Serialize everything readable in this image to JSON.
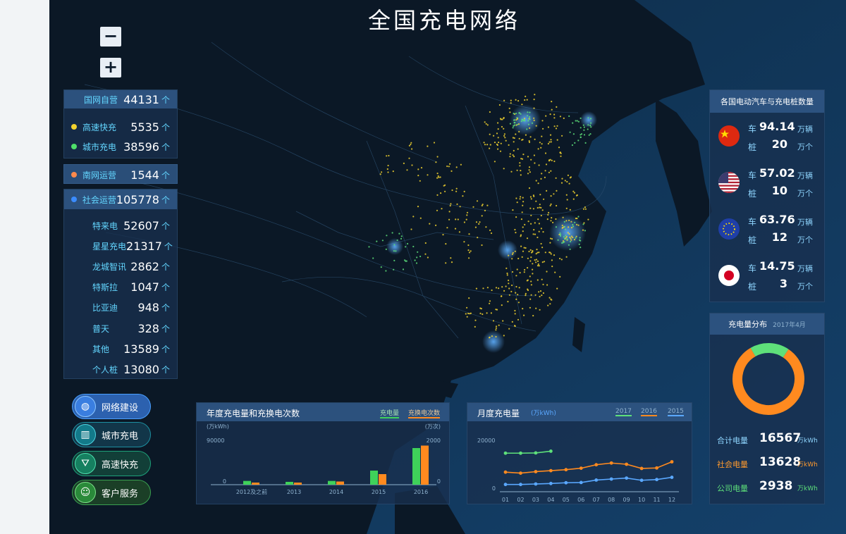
{
  "title": "全国充电网络",
  "zoom": {
    "minus": "−",
    "plus": "+"
  },
  "left_stats": {
    "grid_own": {
      "label": "国网自营",
      "value": "44131",
      "unit": "个"
    },
    "highway": {
      "label": "高速快充",
      "value": "5535",
      "unit": "个",
      "color": "#f2d22e"
    },
    "city": {
      "label": "城市充电",
      "value": "38596",
      "unit": "个",
      "color": "#4ee06a"
    },
    "south_grid": {
      "label": "南网运营",
      "value": "1544",
      "unit": "个",
      "color": "#ff8a4c"
    },
    "social": {
      "label": "社会运营",
      "value": "105778",
      "unit": "个",
      "color": "#3b8cff"
    },
    "operators": [
      {
        "label": "特来电",
        "value": "52607",
        "unit": "个"
      },
      {
        "label": "星星充电",
        "value": "21317",
        "unit": "个"
      },
      {
        "label": "龙城智讯",
        "value": "2862",
        "unit": "个"
      },
      {
        "label": "特斯拉",
        "value": "1047",
        "unit": "个"
      },
      {
        "label": "比亚迪",
        "value": "948",
        "unit": "个"
      },
      {
        "label": "普天",
        "value": "328",
        "unit": "个"
      },
      {
        "label": "其他",
        "value": "13589",
        "unit": "个"
      },
      {
        "label": "个人桩",
        "value": "13080",
        "unit": "个"
      }
    ]
  },
  "nav": [
    {
      "label": "网络建设",
      "icon": "globe-icon"
    },
    {
      "label": "城市充电",
      "icon": "city-icon"
    },
    {
      "label": "高速快充",
      "icon": "highway-icon"
    },
    {
      "label": "客户服务",
      "icon": "user-icon"
    }
  ],
  "countries_panel": {
    "title": "各国电动汽车与充电桩数量",
    "car_label": "车",
    "pile_label": "桩",
    "rows": [
      {
        "flag": "china-flag",
        "cars": "94.14",
        "car_unit": "万辆",
        "piles": "20",
        "pile_unit": "万个"
      },
      {
        "flag": "usa-flag",
        "cars": "57.02",
        "car_unit": "万辆",
        "piles": "10",
        "pile_unit": "万个"
      },
      {
        "flag": "eu-flag",
        "cars": "63.76",
        "car_unit": "万辆",
        "piles": "12",
        "pile_unit": "万个"
      },
      {
        "flag": "japan-flag",
        "cars": "14.75",
        "car_unit": "万辆",
        "piles": "3",
        "pile_unit": "万个"
      }
    ]
  },
  "distribution_panel": {
    "title": "充电量分布",
    "date": "2017年4月",
    "rows": [
      {
        "label": "合计电量",
        "value": "16567",
        "unit": "万kWh",
        "color": "#8fd6ff"
      },
      {
        "label": "社会电量",
        "value": "13628",
        "unit": "万kWh",
        "color": "#ff9a2e"
      },
      {
        "label": "公司电量",
        "value": "2938",
        "unit": "万kWh",
        "color": "#5ee07a"
      }
    ],
    "donut": {
      "social": 13628,
      "company": 2938
    }
  },
  "annual_chart": {
    "title": "年度充电量和充换电次数",
    "legend": [
      "充电量",
      "充换电次数"
    ],
    "left_unit": "(万kWh)",
    "right_unit": "(万次)",
    "left_max": "90000",
    "right_max": "2000",
    "zero": "0",
    "colors": [
      "#3fd15a",
      "#ff8a1f"
    ],
    "chart_data": {
      "type": "bar",
      "categories": [
        "2012及之前",
        "2013",
        "2014",
        "2015",
        "2016"
      ],
      "ylim": [
        0,
        90000
      ],
      "y2lim": [
        0,
        2000
      ],
      "series": [
        {
          "name": "充电量",
          "values": [
            8000,
            6000,
            8000,
            30000,
            78000
          ]
        },
        {
          "name": "充换电次数",
          "values": [
            100,
            100,
            150,
            500,
            1850
          ]
        }
      ]
    }
  },
  "monthly_chart": {
    "title": "月度充电量",
    "unit": "(万kWh)",
    "years": [
      "2017",
      "2016",
      "2015"
    ],
    "y_max": "20000",
    "zero": "0",
    "colors": [
      "#5ee07a",
      "#ff8a1f",
      "#5aa8ff"
    ],
    "chart_data": {
      "type": "line",
      "categories": [
        "01",
        "02",
        "03",
        "04",
        "05",
        "06",
        "07",
        "08",
        "09",
        "10",
        "11",
        "12"
      ],
      "ylim": [
        0,
        20000
      ],
      "series": [
        {
          "name": "2017",
          "values": [
            14500,
            14500,
            14600,
            15300,
            null,
            null,
            null,
            null,
            null,
            null,
            null,
            null
          ]
        },
        {
          "name": "2016",
          "values": [
            6800,
            6400,
            7000,
            7400,
            7800,
            8400,
            9800,
            10500,
            10000,
            8300,
            8500,
            11000
          ]
        },
        {
          "name": "2015",
          "values": [
            1800,
            1800,
            2000,
            2200,
            2500,
            2600,
            3600,
            4000,
            4400,
            3500,
            3800,
            4700
          ]
        }
      ]
    }
  }
}
